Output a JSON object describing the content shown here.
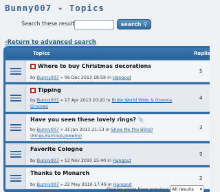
{
  "page": {
    "title": "Bunny007 - Topics"
  },
  "search": {
    "label": "Search these results:",
    "value": "",
    "button_label": "search",
    "button_icon": "search-icon"
  },
  "return_link": "Return to advanced search",
  "table": {
    "header": {
      "topics": "Topics",
      "replies": "Replies"
    },
    "rows": [
      {
        "title": "Where to buy Christmas decorations",
        "has_new_icon": true,
        "by": "by",
        "author": "Bunny007",
        "separator": "»",
        "date": "06 Dec 2013 18:59",
        "in": "in",
        "forum": "Hangout",
        "replies": "5"
      },
      {
        "title": "Tipping",
        "has_new_icon": true,
        "by": "by",
        "author": "Bunny007",
        "separator": "»",
        "date": "17 Apr 2013 20:20",
        "in": "in",
        "forum": "Bride World Wide & Grooms Grooves",
        "replies": "4"
      },
      {
        "title": "Have you seen these lovely rings?",
        "has_attachment_icon": true,
        "by": "by",
        "author": "Bunny007",
        "separator": "»",
        "date": "31 Jan 2011 21:13",
        "in": "in",
        "forum": "Show Me the Bling! (Rings,Earrings,Jewelry)",
        "replies": "3"
      },
      {
        "title": "Favorite Cologne",
        "by": "by",
        "author": "Bunny007",
        "separator": "»",
        "date": "13 Nov 2010 15:40",
        "in": "in",
        "forum": "Hangout",
        "replies": "9"
      },
      {
        "title": "Thanks to Monarch",
        "by": "by",
        "author": "Bunny007",
        "separator": "»",
        "date": "22 May 2010 17:49",
        "in": "in",
        "forum": "Hangout",
        "replies": "2"
      }
    ]
  },
  "footer": {
    "display_label": "Display posts from previous",
    "select_value": "All results"
  },
  "colors": {
    "accent": "#2f6da8",
    "link": "#1f5f9c",
    "title": "#3a6590"
  }
}
